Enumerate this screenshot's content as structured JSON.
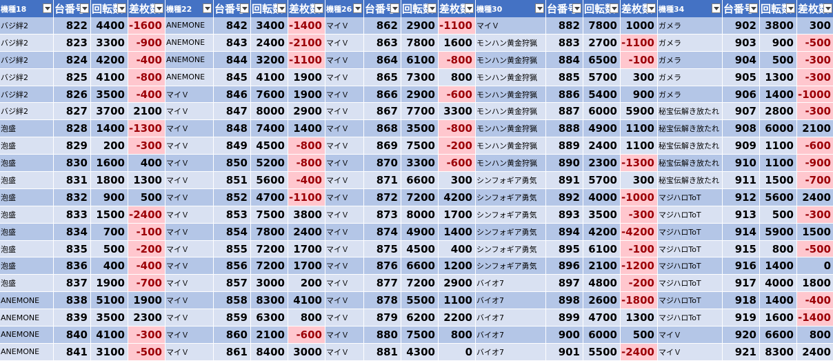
{
  "headers": [
    [
      "機種18",
      "台番号",
      "回転数",
      "差枚数"
    ],
    [
      "機種22",
      "台番号",
      "回転数",
      "差枚数"
    ],
    [
      "機種26",
      "台番号",
      "回転数",
      "差枚数"
    ],
    [
      "機種30",
      "台番号",
      "回転数",
      "差枚数"
    ],
    [
      "機種34",
      "台番号",
      "回転数",
      "差枚数"
    ]
  ],
  "rows": [
    [
      [
        "バジ絆2",
        "822",
        "4400",
        "-1600"
      ],
      [
        "ANEMONE",
        "842",
        "3400",
        "-1400"
      ],
      [
        "マイＶ",
        "862",
        "2900",
        "-1100"
      ],
      [
        "マイＶ",
        "882",
        "7800",
        "1000"
      ],
      [
        "ガメラ",
        "902",
        "3800",
        "300"
      ]
    ],
    [
      [
        "バジ絆2",
        "823",
        "3300",
        "-900"
      ],
      [
        "ANEMONE",
        "843",
        "2400",
        "-2100"
      ],
      [
        "マイＶ",
        "863",
        "7800",
        "1600"
      ],
      [
        "モンハン黄金狩猟",
        "883",
        "2700",
        "-1100"
      ],
      [
        "ガメラ",
        "903",
        "900",
        "-500"
      ]
    ],
    [
      [
        "バジ絆2",
        "824",
        "4200",
        "-400"
      ],
      [
        "ANEMONE",
        "844",
        "3200",
        "-1100"
      ],
      [
        "マイＶ",
        "864",
        "6100",
        "-800"
      ],
      [
        "モンハン黄金狩猟",
        "884",
        "6500",
        "-100"
      ],
      [
        "ガメラ",
        "904",
        "500",
        "-300"
      ]
    ],
    [
      [
        "バジ絆2",
        "825",
        "4100",
        "-800"
      ],
      [
        "ANEMONE",
        "845",
        "4100",
        "1900"
      ],
      [
        "マイＶ",
        "865",
        "7300",
        "800"
      ],
      [
        "モンハン黄金狩猟",
        "885",
        "5700",
        "300"
      ],
      [
        "ガメラ",
        "905",
        "1300",
        "-300"
      ]
    ],
    [
      [
        "バジ絆2",
        "826",
        "3500",
        "-400"
      ],
      [
        "マイＶ",
        "846",
        "7600",
        "1900"
      ],
      [
        "マイＶ",
        "866",
        "2900",
        "-600"
      ],
      [
        "モンハン黄金狩猟",
        "886",
        "5400",
        "900"
      ],
      [
        "ガメラ",
        "906",
        "1400",
        "-1000"
      ]
    ],
    [
      [
        "バジ絆2",
        "827",
        "3700",
        "2100"
      ],
      [
        "マイＶ",
        "847",
        "8000",
        "2900"
      ],
      [
        "マイＶ",
        "867",
        "7700",
        "3300"
      ],
      [
        "モンハン黄金狩猟",
        "887",
        "6000",
        "5900"
      ],
      [
        "秘宝伝解き放たれ",
        "907",
        "2800",
        "-300"
      ]
    ],
    [
      [
        "泡盛",
        "828",
        "1400",
        "-1300"
      ],
      [
        "マイＶ",
        "848",
        "7400",
        "1400"
      ],
      [
        "マイＶ",
        "868",
        "3500",
        "-800"
      ],
      [
        "モンハン黄金狩猟",
        "888",
        "4900",
        "1100"
      ],
      [
        "秘宝伝解き放たれ",
        "908",
        "6000",
        "2100"
      ]
    ],
    [
      [
        "泡盛",
        "829",
        "200",
        "-300"
      ],
      [
        "マイＶ",
        "849",
        "4500",
        "-800"
      ],
      [
        "マイＶ",
        "869",
        "7500",
        "-200"
      ],
      [
        "モンハン黄金狩猟",
        "889",
        "2400",
        "1100"
      ],
      [
        "秘宝伝解き放たれ",
        "909",
        "1100",
        "-600"
      ]
    ],
    [
      [
        "泡盛",
        "830",
        "1600",
        "400"
      ],
      [
        "マイＶ",
        "850",
        "5200",
        "-800"
      ],
      [
        "マイＶ",
        "870",
        "3300",
        "-600"
      ],
      [
        "モンハン黄金狩猟",
        "890",
        "2300",
        "-1300"
      ],
      [
        "秘宝伝解き放たれ",
        "910",
        "1100",
        "-900"
      ]
    ],
    [
      [
        "泡盛",
        "831",
        "1800",
        "1300"
      ],
      [
        "マイＶ",
        "851",
        "5600",
        "-400"
      ],
      [
        "マイＶ",
        "871",
        "6600",
        "300"
      ],
      [
        "シンフォギア勇気",
        "891",
        "5700",
        "300"
      ],
      [
        "秘宝伝解き放たれ",
        "911",
        "1500",
        "-700"
      ]
    ],
    [
      [
        "泡盛",
        "832",
        "900",
        "500"
      ],
      [
        "マイＶ",
        "852",
        "4700",
        "-1100"
      ],
      [
        "マイＶ",
        "872",
        "7200",
        "4200"
      ],
      [
        "シンフォギア勇気",
        "892",
        "4000",
        "-1000"
      ],
      [
        "マジハロToT",
        "912",
        "5600",
        "2400"
      ]
    ],
    [
      [
        "泡盛",
        "833",
        "1500",
        "-2400"
      ],
      [
        "マイＶ",
        "853",
        "7500",
        "3800"
      ],
      [
        "マイＶ",
        "873",
        "8000",
        "1700"
      ],
      [
        "シンフォギア勇気",
        "893",
        "3500",
        "-300"
      ],
      [
        "マジハロToT",
        "913",
        "500",
        "-300"
      ]
    ],
    [
      [
        "泡盛",
        "834",
        "700",
        "-100"
      ],
      [
        "マイＶ",
        "854",
        "7800",
        "2400"
      ],
      [
        "マイＶ",
        "874",
        "4900",
        "1400"
      ],
      [
        "シンフォギア勇気",
        "894",
        "4200",
        "-4200"
      ],
      [
        "マジハロToT",
        "914",
        "5900",
        "1500"
      ]
    ],
    [
      [
        "泡盛",
        "835",
        "500",
        "-200"
      ],
      [
        "マイＶ",
        "855",
        "7200",
        "1700"
      ],
      [
        "マイＶ",
        "875",
        "4500",
        "400"
      ],
      [
        "シンフォギア勇気",
        "895",
        "6100",
        "-100"
      ],
      [
        "マジハロToT",
        "915",
        "800",
        "-500"
      ]
    ],
    [
      [
        "泡盛",
        "836",
        "400",
        "-400"
      ],
      [
        "マイＶ",
        "856",
        "7200",
        "1700"
      ],
      [
        "マイＶ",
        "876",
        "6600",
        "1200"
      ],
      [
        "シンフォギア勇気",
        "896",
        "2100",
        "-1200"
      ],
      [
        "マジハロToT",
        "916",
        "1400",
        "0"
      ]
    ],
    [
      [
        "泡盛",
        "837",
        "1900",
        "-700"
      ],
      [
        "マイＶ",
        "857",
        "3000",
        "200"
      ],
      [
        "マイＶ",
        "877",
        "7200",
        "2900"
      ],
      [
        "バイオ7",
        "897",
        "4800",
        "-200"
      ],
      [
        "マジハロToT",
        "917",
        "4000",
        "1800"
      ]
    ],
    [
      [
        "ANEMONE",
        "838",
        "5100",
        "1900"
      ],
      [
        "マイＶ",
        "858",
        "8300",
        "4100"
      ],
      [
        "マイＶ",
        "878",
        "5500",
        "1100"
      ],
      [
        "バイオ7",
        "898",
        "2600",
        "-1800"
      ],
      [
        "マジハロToT",
        "918",
        "1400",
        "-400"
      ]
    ],
    [
      [
        "ANEMONE",
        "839",
        "3500",
        "2300"
      ],
      [
        "マイＶ",
        "859",
        "6300",
        "800"
      ],
      [
        "マイＶ",
        "879",
        "6200",
        "2200"
      ],
      [
        "バイオ7",
        "899",
        "4700",
        "1300"
      ],
      [
        "マジハロToT",
        "919",
        "1600",
        "-1400"
      ]
    ],
    [
      [
        "ANEMONE",
        "840",
        "4100",
        "-300"
      ],
      [
        "マイＶ",
        "860",
        "2100",
        "-600"
      ],
      [
        "マイＶ",
        "880",
        "7500",
        "800"
      ],
      [
        "バイオ7",
        "900",
        "6000",
        "500"
      ],
      [
        "マイＶ",
        "920",
        "6600",
        "800"
      ]
    ],
    [
      [
        "ANEMONE",
        "841",
        "3100",
        "-500"
      ],
      [
        "マイＶ",
        "861",
        "8400",
        "3000"
      ],
      [
        "マイＶ",
        "881",
        "4300",
        "0"
      ],
      [
        "バイオ7",
        "901",
        "5500",
        "-2400"
      ],
      [
        "マイＶ",
        "921",
        "8300",
        "2400"
      ]
    ]
  ],
  "colors": {
    "header_bg": "#4472c4",
    "band_dark": "#b4c6e7",
    "band_light": "#d9e1f2",
    "negative_bg": "#ffc7ce",
    "negative_text": "#9c0006"
  }
}
